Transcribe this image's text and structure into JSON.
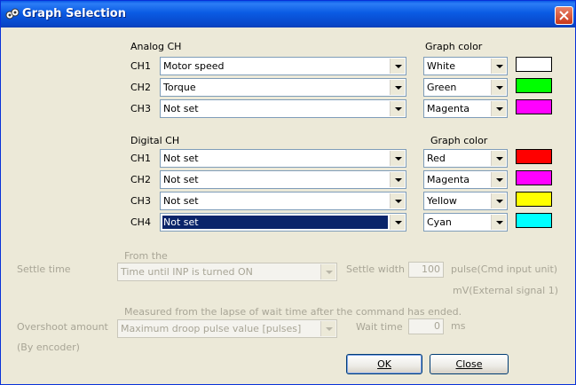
{
  "window": {
    "title": "Graph Selection"
  },
  "analog": {
    "heading": "Analog CH",
    "graph_color_heading": "Graph color",
    "rows": [
      {
        "ch": "CH1",
        "signal": "Motor speed",
        "color_name": "White",
        "swatch": "#FFFFFF"
      },
      {
        "ch": "CH2",
        "signal": "Torque",
        "color_name": "Green",
        "swatch": "#00FF00"
      },
      {
        "ch": "CH3",
        "signal": "Not set",
        "color_name": "Magenta",
        "swatch": "#FF00FF"
      }
    ]
  },
  "digital": {
    "heading": "Digital CH",
    "graph_color_heading": "Graph color",
    "rows": [
      {
        "ch": "CH1",
        "signal": "Not set",
        "color_name": "Red",
        "swatch": "#FF0000"
      },
      {
        "ch": "CH2",
        "signal": "Not set",
        "color_name": "Magenta",
        "swatch": "#FF00FF"
      },
      {
        "ch": "CH3",
        "signal": "Not set",
        "color_name": "Yellow",
        "swatch": "#FFFF00"
      },
      {
        "ch": "CH4",
        "signal": "Not set",
        "color_name": "Cyan",
        "swatch": "#00FFFF"
      }
    ]
  },
  "settle": {
    "label": "Settle time",
    "from_label": "From the",
    "from_value": "Time until INP is turned ON",
    "width_label": "Settle width",
    "width_value": "100",
    "unit_pulse": "pulse(Cmd input unit)",
    "unit_mv": "mV(External signal 1)"
  },
  "overshoot": {
    "caption": "Measured from the lapse of wait time after the command has ended.",
    "label": "Overshoot amount",
    "sublabel": "(By encoder)",
    "value": "Maximum droop pulse value [pulses]",
    "wait_label": "Wait time",
    "wait_value": "0",
    "wait_unit": "ms"
  },
  "buttons": {
    "ok": "OK",
    "close": "Close"
  }
}
